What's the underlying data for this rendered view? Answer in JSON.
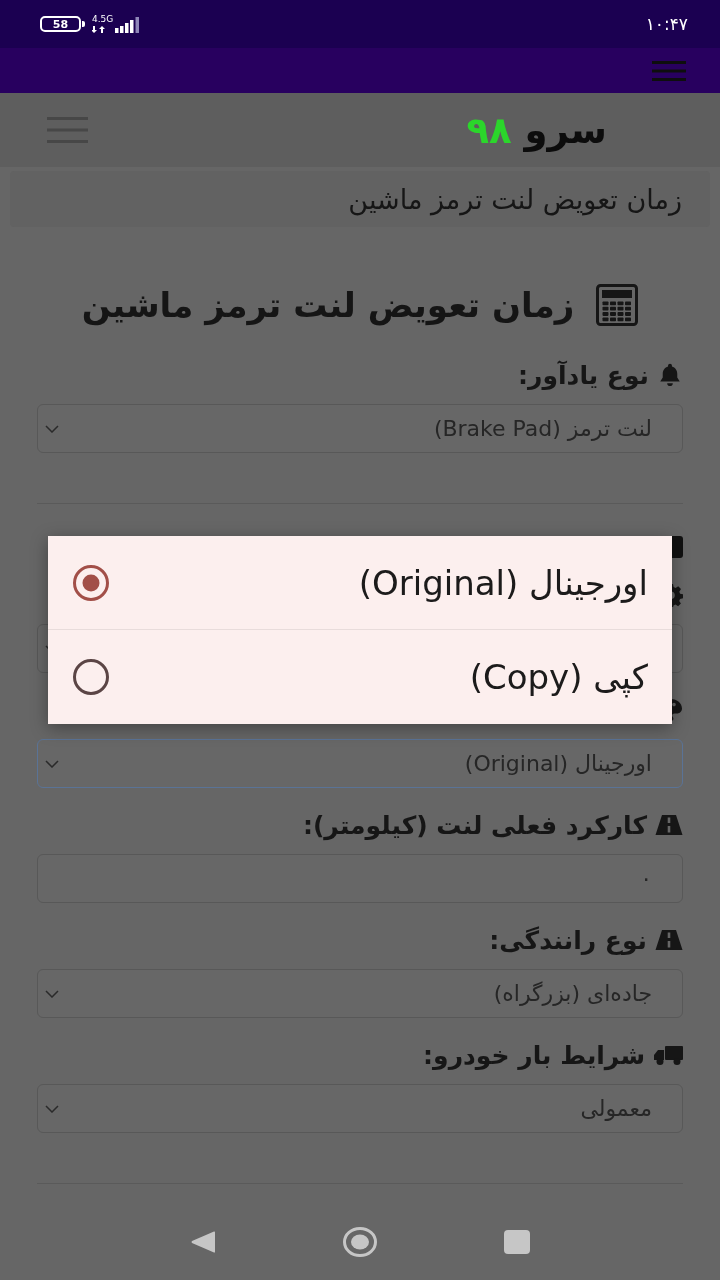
{
  "status_bar": {
    "battery": "58",
    "network": "4.5G",
    "time": "۱۰:۴۷"
  },
  "header": {
    "logo": {
      "name": "سرو",
      "number": "۹۸"
    }
  },
  "breadcrumb": "زمان تعویض لنت ترمز ماشین",
  "title": "زمان تعویض لنت ترمز ماشین",
  "sections": [
    {
      "fields": [
        {
          "kind": "select",
          "label": "نوع یادآور:",
          "value": "لنت ترمز (Brake Pad)",
          "focused": false
        }
      ]
    },
    {
      "fields": [
        {
          "kind": "heading"
        },
        {
          "kind": "select",
          "focused": false
        },
        {
          "kind": "select",
          "value": "اورجینال (Original)",
          "focused": true
        },
        {
          "kind": "input",
          "label": "کارکرد فعلی لنت (کیلومتر):",
          "value": "۰",
          "focused": false
        },
        {
          "kind": "select",
          "label": "نوع رانندگی:",
          "value": "جاده‌ای (بزرگراه)",
          "focused": false
        },
        {
          "kind": "select",
          "label": "شرایط بار خودرو:",
          "value": "معمولی",
          "focused": false
        }
      ]
    }
  ],
  "dialog": {
    "options": [
      {
        "label": "اورجینال (Original)",
        "selected": true
      },
      {
        "label": "کپی (Copy)",
        "selected": false
      }
    ]
  }
}
